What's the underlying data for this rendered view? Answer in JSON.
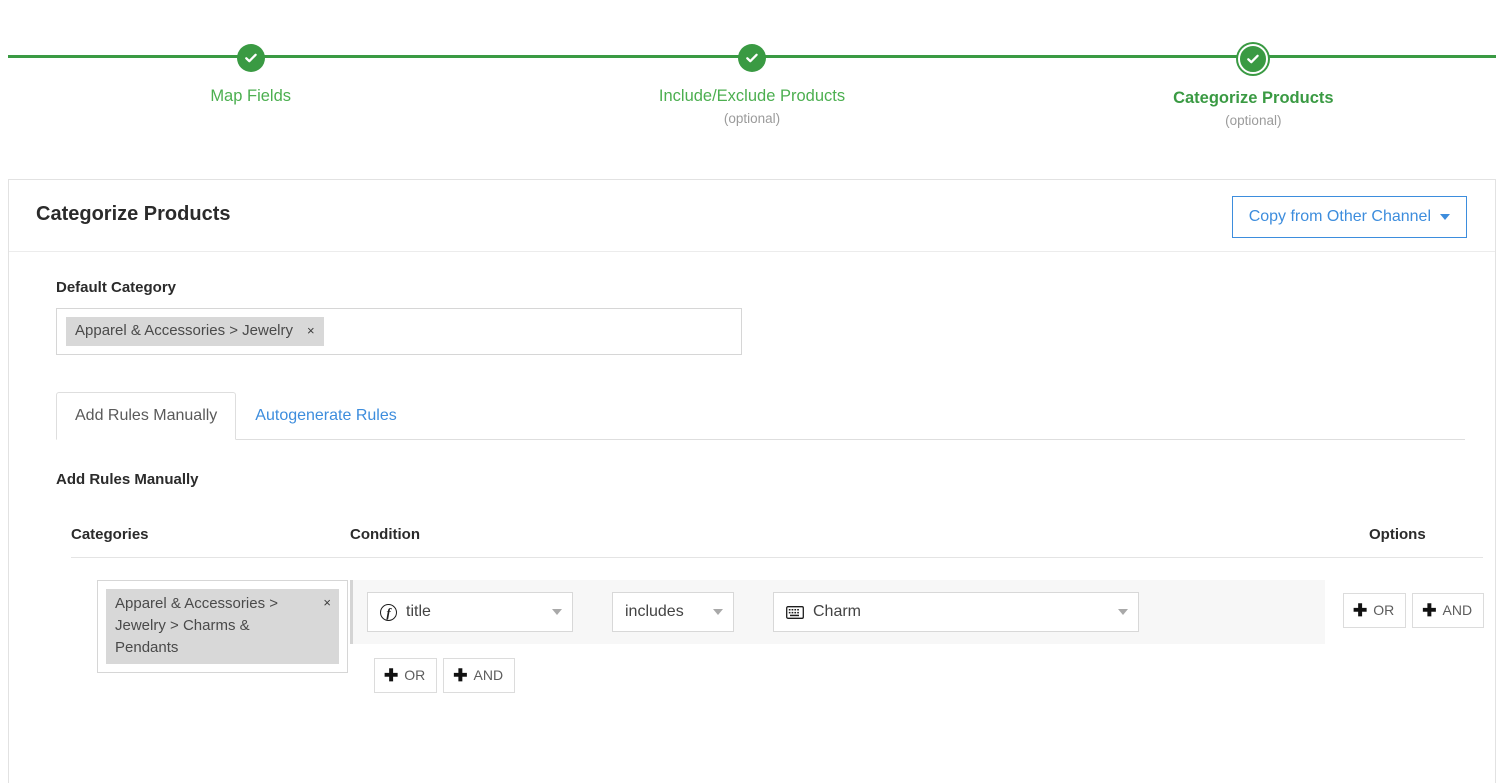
{
  "stepper": {
    "steps": [
      {
        "label": "Map Fields",
        "optional": "",
        "state": "complete",
        "icon": "check-circle-icon"
      },
      {
        "label": "Include/Exclude Products",
        "optional": "(optional)",
        "state": "complete",
        "icon": "check-circle-icon"
      },
      {
        "label": "Categorize Products",
        "optional": "(optional)",
        "state": "active",
        "icon": "check-circle-icon"
      }
    ],
    "line_color": "#3a9a43",
    "label_color": "#4caf50",
    "optional_color": "#9b9b9b"
  },
  "card": {
    "title": "Categorize Products",
    "copy_button": {
      "label": "Copy from Other Channel",
      "icon": "chevron-down-icon",
      "color": "#3d8ddd"
    }
  },
  "default_category": {
    "label": "Default Category",
    "token": "Apparel & Accessories > Jewelry",
    "remove_icon": "×"
  },
  "tabs": [
    {
      "label": "Add Rules Manually",
      "active": true
    },
    {
      "label": "Autogenerate Rules",
      "active": false
    }
  ],
  "section": {
    "title": "Add Rules Manually"
  },
  "table": {
    "headers": {
      "categories": "Categories",
      "condition": "Condition",
      "options": "Options"
    },
    "rows": [
      {
        "category_token": "Apparel & Accessories > Jewelry > Charms & Pendants",
        "remove_icon": "×",
        "condition": {
          "field": {
            "value": "title",
            "icon": "function-icon"
          },
          "operator": {
            "value": "includes"
          },
          "value": {
            "value": "Charm",
            "icon": "keyboard-icon"
          }
        },
        "inner_logic": [
          {
            "label": "OR",
            "icon": "plus-icon"
          },
          {
            "label": "AND",
            "icon": "plus-icon"
          }
        ],
        "outer_logic": [
          {
            "label": "OR",
            "icon": "plus-icon"
          },
          {
            "label": "AND",
            "icon": "plus-icon"
          }
        ],
        "delete": {
          "icon": "trash-icon",
          "color": "#e94b4b"
        }
      }
    ]
  }
}
